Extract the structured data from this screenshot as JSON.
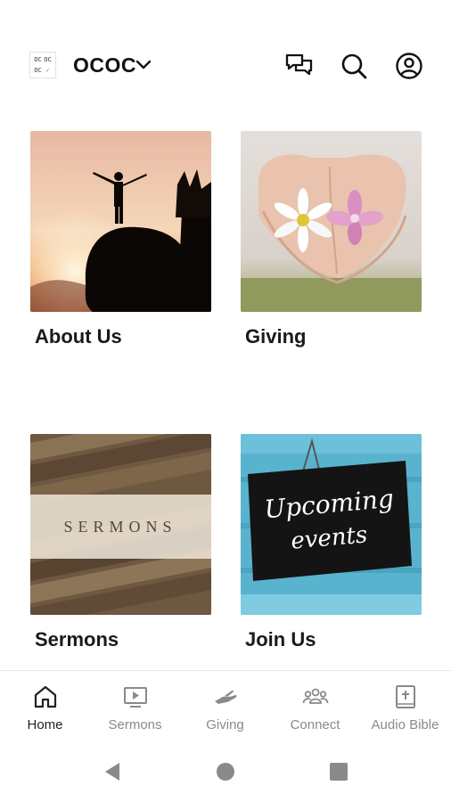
{
  "header": {
    "logo_text": [
      "OC",
      "OC",
      "OC",
      "✓"
    ],
    "org_name": "OCOC",
    "icons": [
      "chat-icon",
      "search-icon",
      "account-icon",
      "chevron-down-icon"
    ]
  },
  "cards": [
    {
      "title": "About Us"
    },
    {
      "title": "Giving"
    },
    {
      "title": "Sermons",
      "image_text": "SERMONS"
    },
    {
      "title": "Join Us",
      "image_text_line1": "Upcoming",
      "image_text_line2": "events"
    }
  ],
  "bottom_nav": [
    {
      "label": "Home",
      "icon": "home-icon",
      "active": true
    },
    {
      "label": "Sermons",
      "icon": "video-icon",
      "active": false
    },
    {
      "label": "Giving",
      "icon": "hand-icon",
      "active": false
    },
    {
      "label": "Connect",
      "icon": "group-icon",
      "active": false
    },
    {
      "label": "Audio Bible",
      "icon": "bible-icon",
      "active": false
    }
  ],
  "colors": {
    "text": "#111111",
    "nav_inactive": "#8a8a8a",
    "nav_active": "#222222",
    "divider": "#e6e6e6"
  }
}
